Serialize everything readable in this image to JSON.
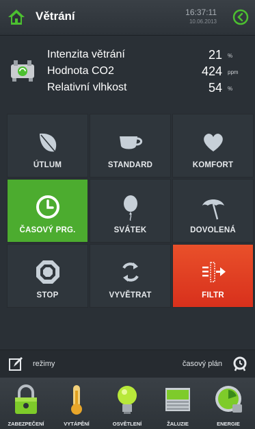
{
  "header": {
    "title": "Větrání",
    "time": "16:37:11",
    "date": "10.06.2013"
  },
  "info": {
    "rows": [
      {
        "label": "Intenzita větrání",
        "value": "21",
        "unit": "%"
      },
      {
        "label": "Hodnota CO2",
        "value": "424",
        "unit": "ppm"
      },
      {
        "label": "Relativní vlhkost",
        "value": "54",
        "unit": "%"
      }
    ]
  },
  "modes": [
    {
      "label": "ÚTLUM",
      "icon": "leaf-icon"
    },
    {
      "label": "STANDARD",
      "icon": "cup-icon"
    },
    {
      "label": "KOMFORT",
      "icon": "heart-icon"
    },
    {
      "label": "ČASOVÝ PRG.",
      "icon": "clock-icon",
      "active": true
    },
    {
      "label": "SVÁTEK",
      "icon": "balloon-icon"
    },
    {
      "label": "DOVOLENÁ",
      "icon": "umbrella-icon"
    },
    {
      "label": "STOP",
      "icon": "stop-icon"
    },
    {
      "label": "VYVĚTRAT",
      "icon": "refresh-icon"
    },
    {
      "label": "FILTR",
      "icon": "filter-icon",
      "highlight": true
    }
  ],
  "bottom_bar": {
    "left_label": "režimy",
    "right_label": "časový plán"
  },
  "nav": [
    {
      "label": "ZABEZPEČENÍ",
      "icon": "padlock-icon"
    },
    {
      "label": "VYTÁPĚNÍ",
      "icon": "thermometer-icon"
    },
    {
      "label": "OSVĚTLENÍ",
      "icon": "lightbulb-icon"
    },
    {
      "label": "ŽALUZIE",
      "icon": "blinds-icon"
    },
    {
      "label": "ENERGIE",
      "icon": "energy-meter-icon"
    }
  ],
  "colors": {
    "active": "#4cac2f",
    "filter": "#e0401f",
    "accent_green": "#3fbf2f"
  }
}
